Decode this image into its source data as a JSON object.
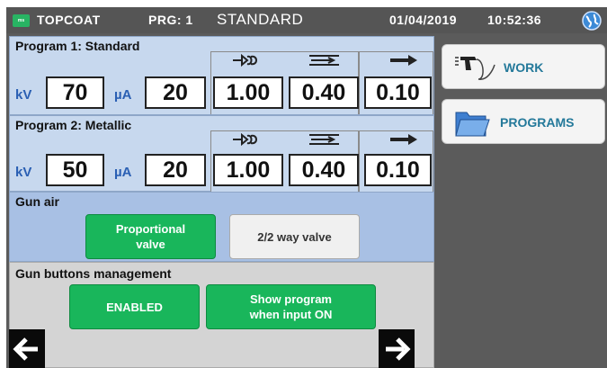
{
  "titlebar": {
    "logo": "ms",
    "app_name": "TOPCOAT",
    "program": "PRG: 1",
    "program_name": "STANDARD",
    "date": "01/04/2019",
    "time": "10:52:36",
    "globe_icon": "globe-icon"
  },
  "program1": {
    "title": "Program 1: Standard",
    "kv_label": "kV",
    "kv_value": "70",
    "ua_label": "µA",
    "ua_value": "20",
    "col1_value": "1.00",
    "col2_value": "0.40",
    "col3_value": "0.10"
  },
  "program2": {
    "title": "Program 2: Metallic",
    "kv_label": "kV",
    "kv_value": "50",
    "ua_label": "µA",
    "ua_value": "20",
    "col1_value": "1.00",
    "col2_value": "0.40",
    "col3_value": "0.10"
  },
  "gun_air": {
    "title": "Gun air",
    "proportional_line1": "Proportional",
    "proportional_line2": "valve",
    "two_way": "2/2 way valve"
  },
  "gun_buttons": {
    "title": "Gun buttons management",
    "enabled": "ENABLED",
    "show_line1": "Show program",
    "show_line2": "when input ON"
  },
  "side": {
    "work": "WORK",
    "programs": "PROGRAMS"
  },
  "colors": {
    "green": "#19b65b",
    "panel_blue": "#c7d8ee",
    "link_teal": "#24799a"
  }
}
